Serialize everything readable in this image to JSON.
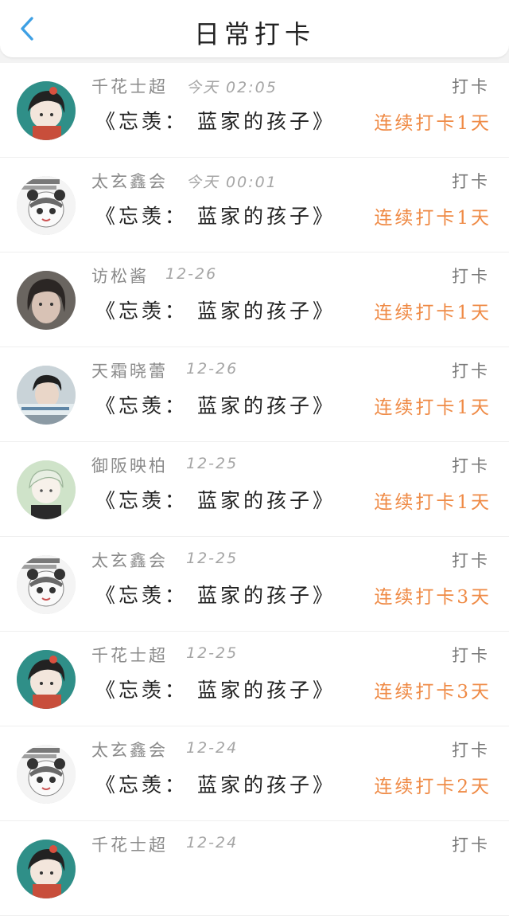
{
  "header": {
    "back_icon": "chevron-left-icon",
    "title": "日常打卡"
  },
  "colors": {
    "accent": "#3ea0e4",
    "streak": "#ef8a45"
  },
  "rows": [
    {
      "avatar": "teal",
      "name": "千花士超",
      "time": "今天 02:05",
      "tag": "打卡",
      "book": "《忘羡： 蓝家的孩子》",
      "streak": "连续打卡1天"
    },
    {
      "avatar": "panda",
      "name": "太玄鑫会",
      "time": "今天 00:01",
      "tag": "打卡",
      "book": "《忘羡： 蓝家的孩子》",
      "streak": "连续打卡1天"
    },
    {
      "avatar": "photo",
      "name": "访松酱",
      "time": "12-26",
      "tag": "打卡",
      "book": "《忘羡： 蓝家的孩子》",
      "streak": "连续打卡1天"
    },
    {
      "avatar": "boy",
      "name": "天霜晓蕾",
      "time": "12-26",
      "tag": "打卡",
      "book": "《忘羡： 蓝家的孩子》",
      "streak": "连续打卡1天"
    },
    {
      "avatar": "anime",
      "name": "御阪映柏",
      "time": "12-25",
      "tag": "打卡",
      "book": "《忘羡： 蓝家的孩子》",
      "streak": "连续打卡1天"
    },
    {
      "avatar": "panda",
      "name": "太玄鑫会",
      "time": "12-25",
      "tag": "打卡",
      "book": "《忘羡： 蓝家的孩子》",
      "streak": "连续打卡3天"
    },
    {
      "avatar": "teal",
      "name": "千花士超",
      "time": "12-25",
      "tag": "打卡",
      "book": "《忘羡： 蓝家的孩子》",
      "streak": "连续打卡3天"
    },
    {
      "avatar": "panda",
      "name": "太玄鑫会",
      "time": "12-24",
      "tag": "打卡",
      "book": "《忘羡： 蓝家的孩子》",
      "streak": "连续打卡2天"
    },
    {
      "avatar": "teal",
      "name": "千花士超",
      "time": "12-24",
      "tag": "打卡",
      "book": "",
      "streak": ""
    }
  ]
}
